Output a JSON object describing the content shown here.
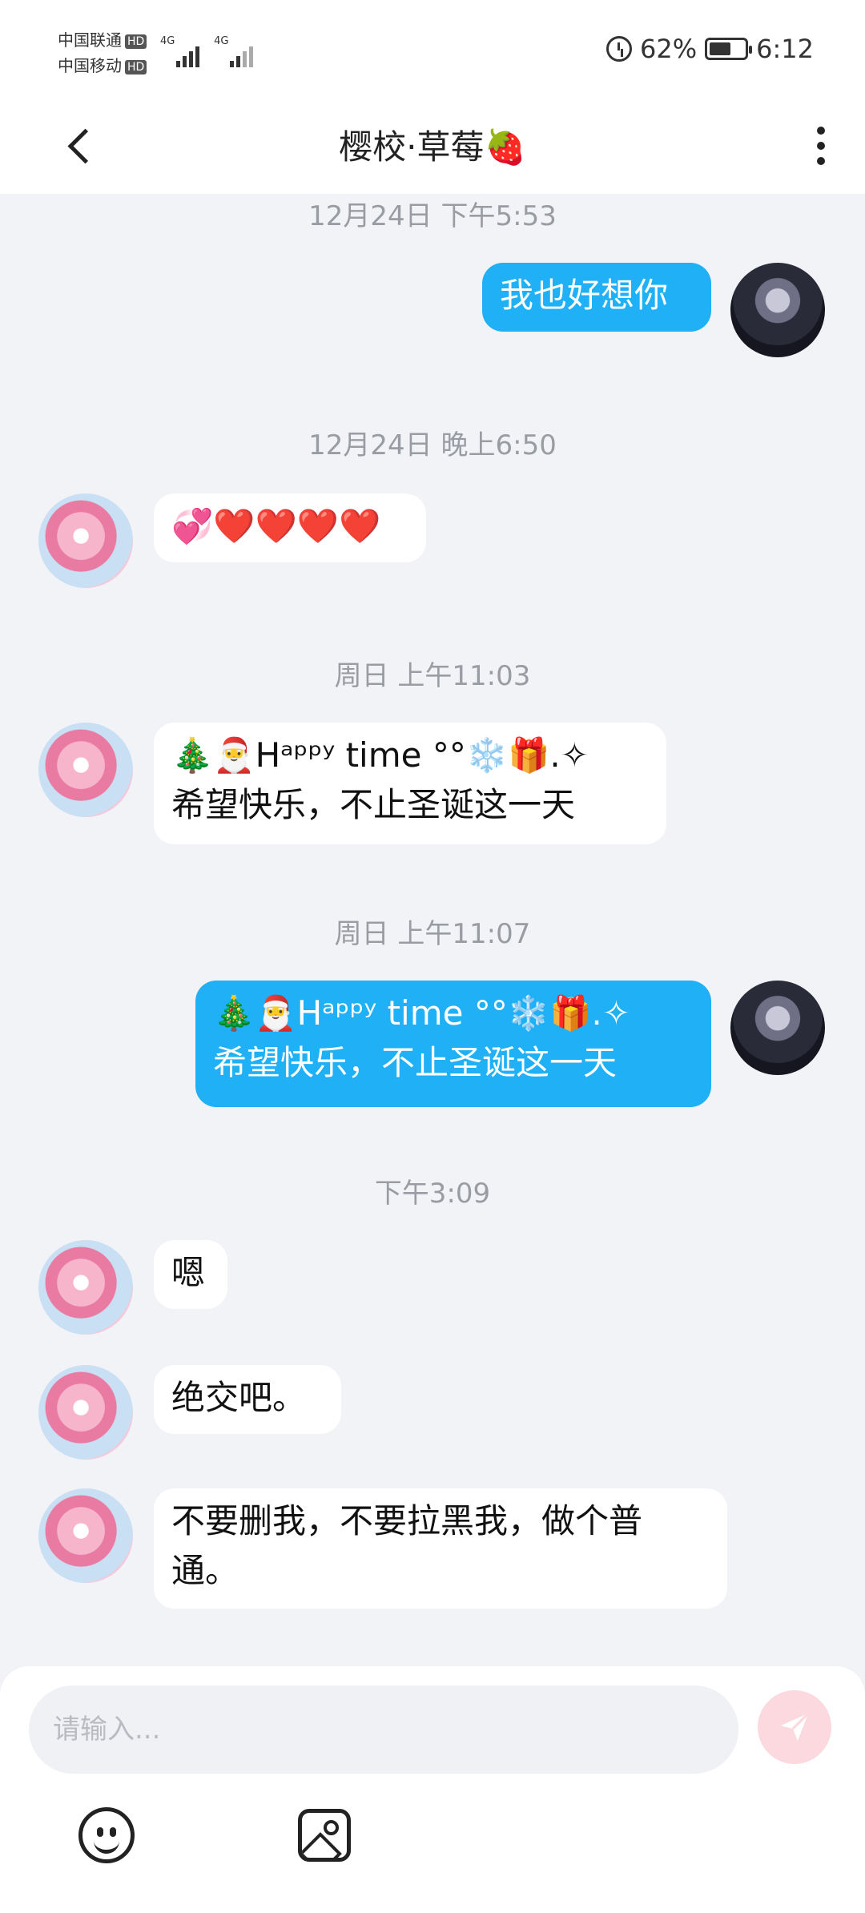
{
  "status_bar": {
    "carrier1": "中国联通",
    "carrier2": "中国移动",
    "hd": "HD",
    "net1": "4G",
    "net2": "4G",
    "battery_percent": "62%",
    "battery_level": 0.62,
    "time": "6:12"
  },
  "header": {
    "title": "樱校·草莓🍓"
  },
  "messages": [
    {
      "type": "timestamp",
      "text": "12月24日 下午5:53"
    },
    {
      "type": "message",
      "side": "out",
      "avatar": "dark-anime-avatar",
      "lines": [
        "我也好想你"
      ]
    },
    {
      "type": "timestamp",
      "text": "12月24日 晚上6:50"
    },
    {
      "type": "message",
      "side": "in",
      "avatar": "pink-anime-avatar",
      "lines": [
        "💞❤️❤️❤️❤️"
      ]
    },
    {
      "type": "timestamp",
      "text": "周日 上午11:03"
    },
    {
      "type": "message",
      "side": "in",
      "avatar": "pink-anime-avatar",
      "lines": [
        "🎄🎅Hᵃᵖᵖʸ time °°❄️🎁.✧",
        "希望快乐，不止圣诞这一天"
      ]
    },
    {
      "type": "timestamp",
      "text": "周日 上午11:07"
    },
    {
      "type": "message",
      "side": "out",
      "avatar": "dark-anime-avatar",
      "lines": [
        "🎄🎅Hᵃᵖᵖʸ time °°❄️🎁.✧",
        "希望快乐，不止圣诞这一天"
      ]
    },
    {
      "type": "timestamp",
      "text": "下午3:09"
    },
    {
      "type": "message",
      "side": "in",
      "avatar": "pink-anime-avatar",
      "lines": [
        "嗯"
      ]
    },
    {
      "type": "message",
      "side": "in",
      "avatar": "pink-anime-avatar",
      "lines": [
        "绝交吧。"
      ]
    },
    {
      "type": "message",
      "side": "in",
      "avatar": "pink-anime-avatar",
      "lines": [
        "不要删我，不要拉黑我，做个普",
        "通。"
      ]
    }
  ],
  "input": {
    "placeholder": "请输入..."
  },
  "icons": {
    "back": "back-arrow-icon",
    "menu": "more-vertical-icon",
    "send": "send-icon",
    "emoji": "emoji-icon",
    "image": "image-icon"
  },
  "colors": {
    "outgoing_bubble": "#1fb0f5",
    "incoming_bubble": "#ffffff",
    "background": "#f2f3f7",
    "send_button": "#fbd9de"
  }
}
